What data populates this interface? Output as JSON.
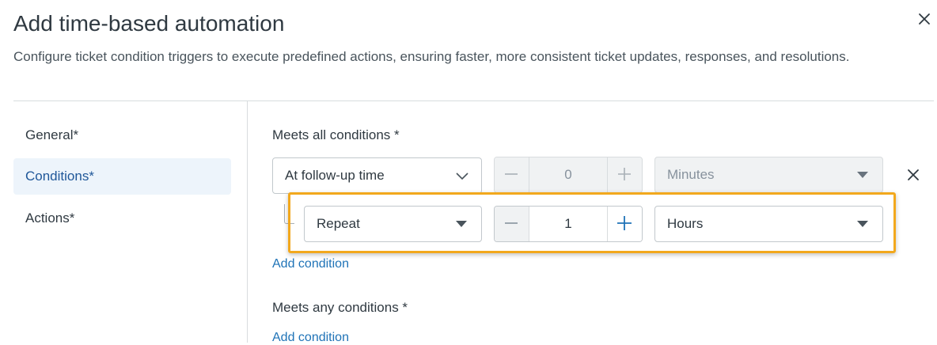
{
  "header": {
    "title": "Add time-based automation",
    "subtitle": "Configure ticket condition triggers to execute predefined actions, ensuring faster, more consistent ticket updates, responses, and resolutions."
  },
  "nav": {
    "items": [
      {
        "label": "General*",
        "active": false
      },
      {
        "label": "Conditions*",
        "active": true
      },
      {
        "label": "Actions*",
        "active": false
      }
    ]
  },
  "conditions": {
    "all_title": "Meets all conditions *",
    "row1": {
      "field": "At follow-up time",
      "value": "0",
      "unit": "Minutes"
    },
    "row2": {
      "field": "Repeat",
      "value": "1",
      "unit": "Hours"
    },
    "add_condition_label": "Add condition",
    "any_title": "Meets any conditions *",
    "add_condition_any_label": "Add condition"
  },
  "colors": {
    "accent": "#1f73b7",
    "highlight": "#f2a81d",
    "active_nav_bg": "#edf4fb"
  }
}
